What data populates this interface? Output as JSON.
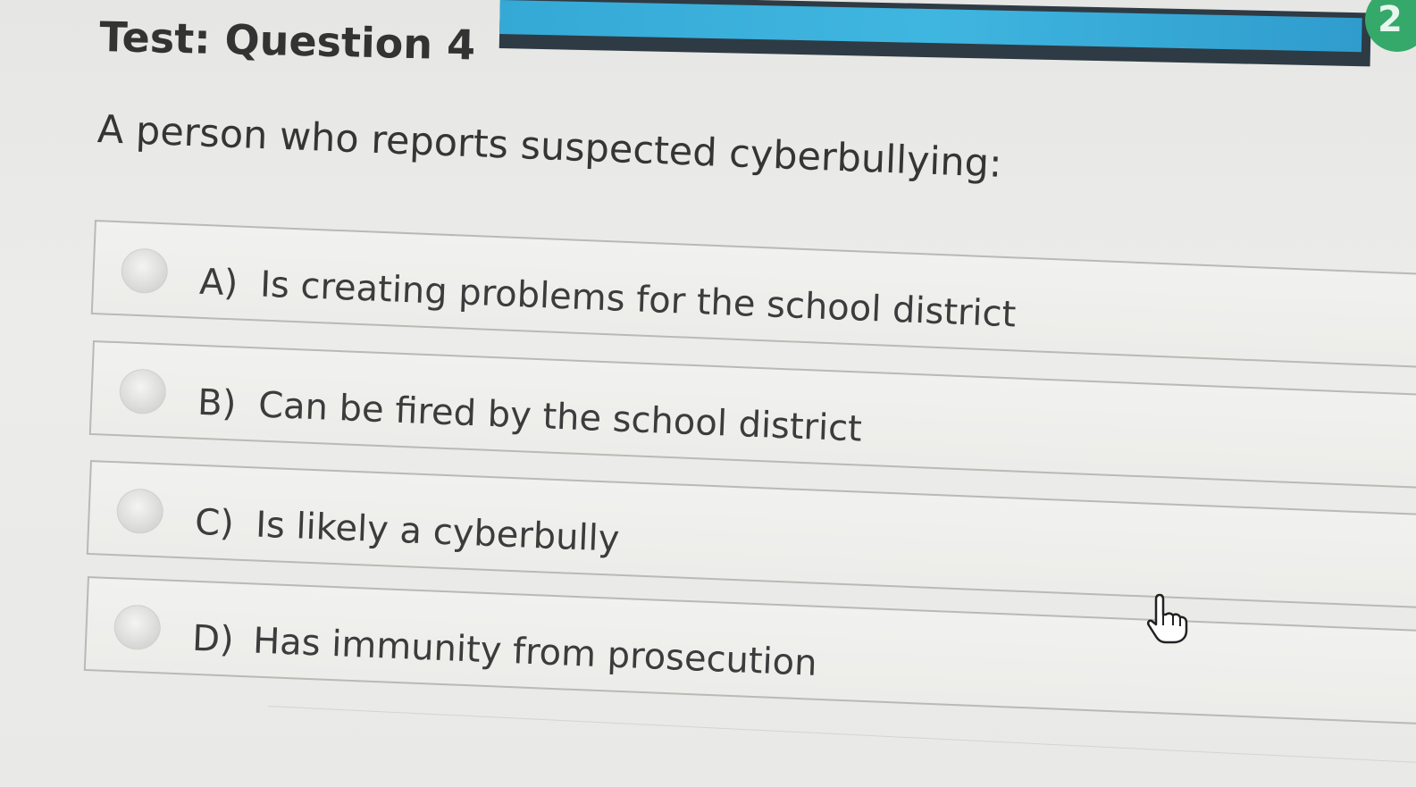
{
  "header": {
    "title": "Test: Question 4",
    "progress_fraction": 0.99,
    "badge": "2"
  },
  "question": {
    "prompt": "A person who reports suspected cyberbullying:"
  },
  "options": [
    {
      "letter": "A)",
      "text": "Is creating problems for the school district",
      "selected": false
    },
    {
      "letter": "B)",
      "text": "Can be fired by the school district",
      "selected": false
    },
    {
      "letter": "C)",
      "text": "Is likely a cyberbully",
      "selected": false
    },
    {
      "letter": "D)",
      "text": "Has immunity from prosecution",
      "selected": false
    }
  ],
  "cursor": {
    "icon": "hand-pointer-icon"
  },
  "colors": {
    "progress_fill": "#3fb6e0",
    "progress_track": "#2e3b44",
    "badge": "#35a96a",
    "background": "#e9e9e7"
  }
}
